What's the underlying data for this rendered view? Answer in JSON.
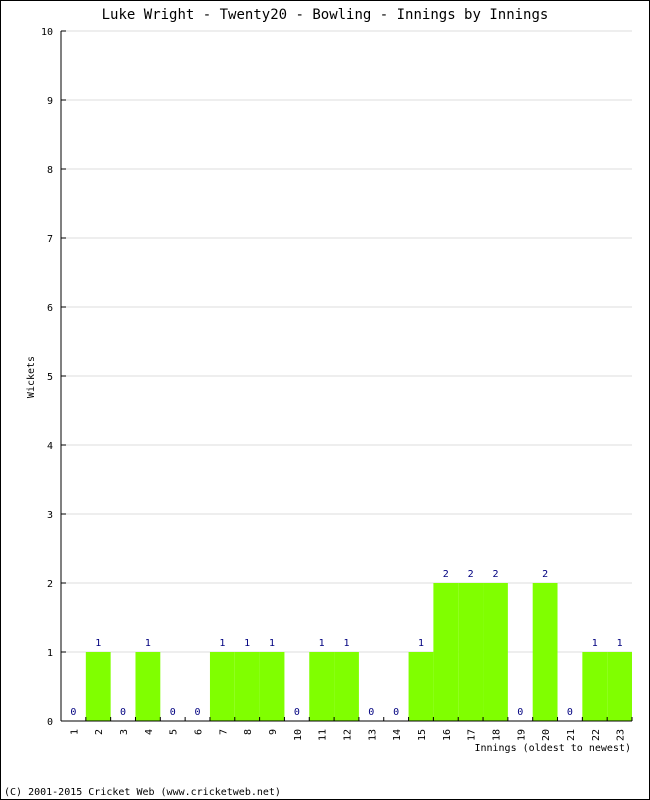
{
  "chart_data": {
    "type": "bar",
    "title": "Luke Wright - Twenty20 - Bowling - Innings by Innings",
    "xlabel": "Innings (oldest to newest)",
    "ylabel": "Wickets",
    "ylim": [
      0,
      10
    ],
    "yticks": [
      0,
      1,
      2,
      3,
      4,
      5,
      6,
      7,
      8,
      9,
      10
    ],
    "grid": true,
    "categories": [
      "1",
      "2",
      "3",
      "4",
      "5",
      "6",
      "7",
      "8",
      "9",
      "10",
      "11",
      "12",
      "13",
      "14",
      "15",
      "16",
      "17",
      "18",
      "19",
      "20",
      "21",
      "22",
      "23"
    ],
    "values": [
      0,
      1,
      0,
      1,
      0,
      0,
      1,
      1,
      1,
      0,
      1,
      1,
      0,
      0,
      1,
      2,
      2,
      2,
      0,
      2,
      0,
      1,
      1
    ],
    "bar_color": "#80ff00",
    "label_color": "#000080",
    "grid_color": "#dddddd"
  },
  "footer": "(C) 2001-2015 Cricket Web (www.cricketweb.net)"
}
